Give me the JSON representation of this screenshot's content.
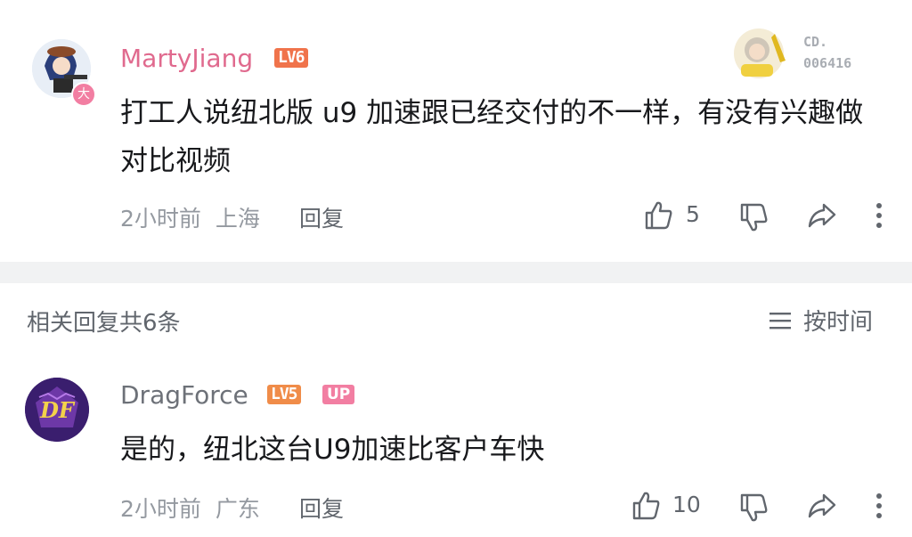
{
  "comment": {
    "username": "MartyJiang",
    "level": "LV6",
    "avatar_badge": "大",
    "text": "打工人说纽北版 u9 加速跟已经交付的不一样，有没有兴趣做对比视频",
    "time": "2小时前",
    "location": "上海",
    "reply_label": "回复",
    "likes": "5",
    "fan_badge_label": "CD.",
    "fan_badge_number": "006416"
  },
  "replies_header": {
    "title": "相关回复共6条",
    "sort_label": "按时间"
  },
  "reply": {
    "username": "DragForce",
    "level": "LV5",
    "up_tag": "UP",
    "avatar_text": "DF",
    "text": "是的，纽北这台U9加速比客户车快",
    "time": "2小时前",
    "location": "广东",
    "reply_label": "回复",
    "likes": "10"
  },
  "colors": {
    "username_pink": "#e06a8e",
    "lv6": "#f0734b",
    "lv5": "#f08c49",
    "up": "#f27ea2",
    "muted": "#9499a0"
  }
}
